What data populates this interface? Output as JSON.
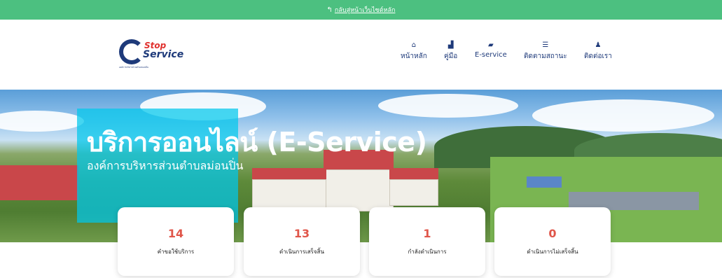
{
  "topbar": {
    "back_icon": "↰",
    "link_text": "กลับสู่หน้าเว็บไซต์หลัก",
    "bg": "#4cc080"
  },
  "logo": {
    "line1": "Stop",
    "line2": "Service",
    "org": "องค์การบริหารส่วนตำบลม่อนปิ่น"
  },
  "nav": [
    {
      "icon": "home-icon",
      "glyph": "⌂",
      "label": "หน้าหลัก"
    },
    {
      "icon": "manual-icon",
      "glyph": "▟",
      "label": "คู่มือ"
    },
    {
      "icon": "folder-icon",
      "glyph": "▰",
      "label": "E-service"
    },
    {
      "icon": "list-icon",
      "glyph": "☰",
      "label": "ติดตามสถานะ"
    },
    {
      "icon": "contact-icon",
      "glyph": "♟",
      "label": "ติดต่อเรา"
    }
  ],
  "hero": {
    "title": "บริการออนไลน์ (E-Service)",
    "subtitle": "องค์การบริหารส่วนตำบลม่อนปิ่น"
  },
  "stats": [
    {
      "value": "14",
      "label": "คำขอใช้บริการ"
    },
    {
      "value": "13",
      "label": "ดำเนินการเสร็จสิ้น"
    },
    {
      "value": "1",
      "label": "กำลังดำเนินการ"
    },
    {
      "value": "0",
      "label": "ดำเนินการไม่เสร็จสิ้น"
    }
  ],
  "colors": {
    "accent_number": "#e0564a",
    "nav_text": "#1e3a7a",
    "hero_panel": "#00c8eb"
  }
}
